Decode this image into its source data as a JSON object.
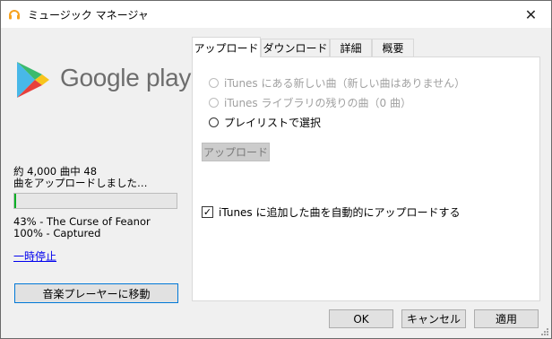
{
  "window": {
    "title": "ミュージック マネージャ",
    "app_icon": "headphones-icon",
    "close_glyph": "✕",
    "accent_color": "#f6a21e"
  },
  "brand": {
    "logo_icon": "google-play-logo-icon",
    "wordmark": "Google play"
  },
  "status": {
    "line1": "約 4,000 曲中 48",
    "line2": "曲をアップロードしました…",
    "progress_percent": 1.2,
    "progress_color": "#06b025"
  },
  "tracks": [
    "43% - The Curse of Feanor",
    "100% - Captured"
  ],
  "pause_label": "一時停止",
  "goto_player_label": "音楽プレーヤーに移動",
  "tabs": [
    {
      "label": "アップロード",
      "active": true
    },
    {
      "label": "ダウンロード",
      "active": false
    },
    {
      "label": "詳細",
      "active": false
    },
    {
      "label": "概要",
      "active": false
    }
  ],
  "upload_panel": {
    "options": [
      {
        "label": "iTunes にある新しい曲（新しい曲はありません）",
        "enabled": false,
        "selected": false
      },
      {
        "label": "iTunes ライブラリの残りの曲（0 曲）",
        "enabled": false,
        "selected": false
      },
      {
        "label": "プレイリストで選択",
        "enabled": true,
        "selected": false
      }
    ],
    "upload_button_label": "アップロード",
    "auto_upload_label": "iTunes に追加した曲を自動的にアップロードする",
    "auto_upload_checked": true,
    "check_glyph": "✓"
  },
  "dialog_buttons": {
    "ok": "OK",
    "cancel": "キャンセル",
    "apply": "適用"
  }
}
